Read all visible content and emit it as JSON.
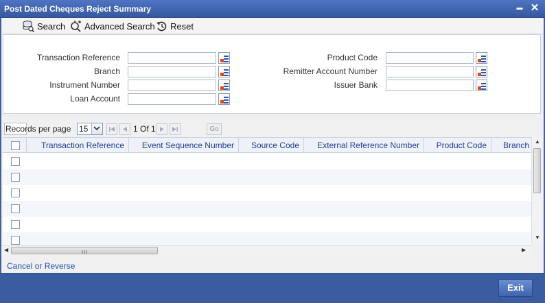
{
  "window": {
    "title": "Post Dated Cheques Reject Summary",
    "minimize": "▬",
    "close": "✕"
  },
  "toolbar": {
    "search": "Search",
    "advanced_search": "Advanced Search",
    "reset": "Reset"
  },
  "criteria": {
    "left": [
      {
        "label": "Transaction Reference",
        "value": ""
      },
      {
        "label": "Branch",
        "value": ""
      },
      {
        "label": "Instrument Number",
        "value": ""
      },
      {
        "label": "Loan Account",
        "value": ""
      }
    ],
    "right": [
      {
        "label": "Product Code",
        "value": ""
      },
      {
        "label": "Remitter Account Number",
        "value": ""
      },
      {
        "label": "Issuer Bank",
        "value": ""
      }
    ]
  },
  "pager": {
    "records_label": "Records per page",
    "records_value": "15",
    "page_info": "1 Of 1",
    "go_value": "",
    "go_label": "Go"
  },
  "grid": {
    "columns": [
      "Transaction Reference",
      "Event Sequence Number",
      "Source Code",
      "External Reference Number",
      "Product Code",
      "Branch"
    ]
  },
  "links": {
    "cancel_reverse": "Cancel or Reverse"
  },
  "footer": {
    "exit": "Exit"
  },
  "colors": {
    "titlebar": "#3e5fa3",
    "header_text": "#1f3f8f",
    "link": "#1f4ea8"
  }
}
